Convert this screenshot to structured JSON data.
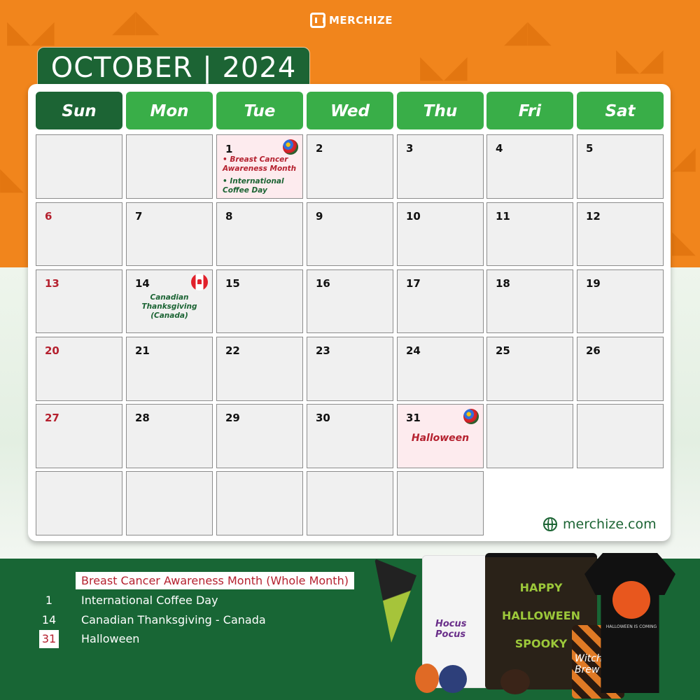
{
  "brand": {
    "logo_text": "MERCHIZE",
    "website": "merchize.com"
  },
  "calendar": {
    "title": "OCTOBER | 2024",
    "weekdays": [
      "Sun",
      "Mon",
      "Tue",
      "Wed",
      "Thu",
      "Fri",
      "Sat"
    ],
    "days": {
      "d1": "1",
      "d2": "2",
      "d3": "3",
      "d4": "4",
      "d5": "5",
      "d6": "6",
      "d7": "7",
      "d8": "8",
      "d9": "9",
      "d10": "10",
      "d11": "11",
      "d12": "12",
      "d13": "13",
      "d14": "14",
      "d15": "15",
      "d16": "16",
      "d17": "17",
      "d18": "18",
      "d19": "19",
      "d20": "20",
      "d21": "21",
      "d22": "22",
      "d23": "23",
      "d24": "24",
      "d25": "25",
      "d26": "26",
      "d27": "27",
      "d28": "28",
      "d29": "29",
      "d30": "30",
      "d31": "31"
    },
    "events": {
      "oct1_a": "• Breast Cancer Awareness Month",
      "oct1_b": "• International Coffee Day",
      "oct14": "Canadian Thanksgiving (Canada)",
      "oct31": "Halloween"
    },
    "colors": {
      "header_green": "#39ae48",
      "sunday_green": "#1c6434",
      "holiday_red": "#b5212f",
      "highlight_pink": "#fdebee",
      "top_orange": "#f1851c"
    }
  },
  "legend": [
    {
      "date": "",
      "label": "Breast Cancer Awareness Month (Whole Month)"
    },
    {
      "date": "1",
      "label": "International Coffee Day"
    },
    {
      "date": "14",
      "label": "Canadian Thanksgiving - Canada"
    },
    {
      "date": "31",
      "label": "Halloween"
    }
  ],
  "merch_texts": {
    "sweater": "HAPPY HALLOWEEN SPOOKY",
    "tshirt": "HALLOWEEN IS COMING",
    "tote": "Witchy Brew",
    "hoodie": "Hocus Pocus"
  }
}
